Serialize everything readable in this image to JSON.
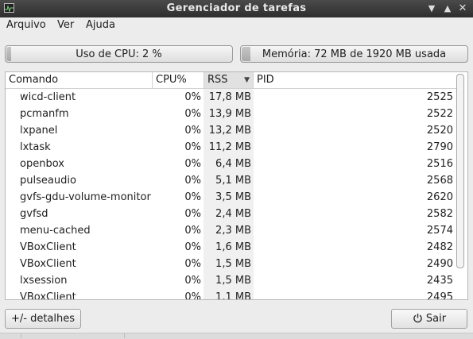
{
  "window": {
    "title": "Gerenciador de tarefas"
  },
  "menu": [
    "Arquivo",
    "Ver",
    "Ajuda"
  ],
  "cpu_meter": {
    "label": "Uso de CPU: 2 %",
    "fraction": 0.02
  },
  "memory_meter": {
    "label": "Memória: 72 MB de 1920 MB usada",
    "fraction": 0.0375
  },
  "table": {
    "columns": [
      "Comando",
      "CPU%",
      "RSS",
      "PID"
    ],
    "sorted_column": "RSS",
    "rows": [
      [
        "wicd-client",
        "0%",
        "17,8 MB",
        "2525"
      ],
      [
        "pcmanfm",
        "0%",
        "13,9 MB",
        "2522"
      ],
      [
        "lxpanel",
        "0%",
        "13,2 MB",
        "2520"
      ],
      [
        "lxtask",
        "0%",
        "11,2 MB",
        "2790"
      ],
      [
        "openbox",
        "0%",
        "6,4 MB",
        "2516"
      ],
      [
        "pulseaudio",
        "0%",
        "5,1 MB",
        "2568"
      ],
      [
        "gvfs-gdu-volume-monitor",
        "0%",
        "3,5 MB",
        "2620"
      ],
      [
        "gvfsd",
        "0%",
        "2,4 MB",
        "2582"
      ],
      [
        "menu-cached",
        "0%",
        "2,3 MB",
        "2574"
      ],
      [
        "VBoxClient",
        "0%",
        "1,6 MB",
        "2482"
      ],
      [
        "VBoxClient",
        "0%",
        "1,5 MB",
        "2490"
      ],
      [
        "lxsession",
        "0%",
        "1,5 MB",
        "2435"
      ],
      [
        "VBoxClient",
        "0%",
        "1,1 MB",
        "2495"
      ]
    ]
  },
  "buttons": {
    "details": "+/- detalhes",
    "quit": "Sair"
  },
  "icons": {
    "app": "task-manager-icon",
    "quit": "power-icon",
    "sort": "sort-down-icon"
  }
}
